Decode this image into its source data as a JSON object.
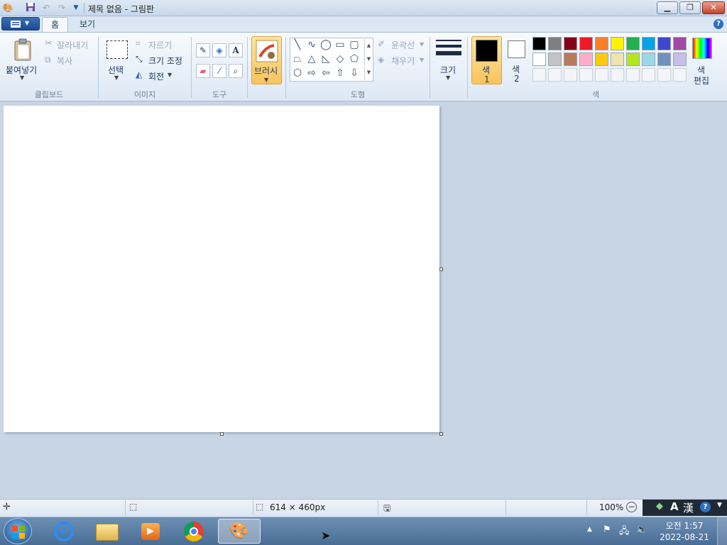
{
  "window": {
    "title": "제목 없음 - 그림판"
  },
  "tabs": [
    {
      "label": "홈"
    },
    {
      "label": "보기"
    }
  ],
  "clipboard": {
    "paste": "붙여넣기",
    "cut": "잘라내기",
    "copy": "복사",
    "group": "클립보드"
  },
  "image": {
    "select": "선택",
    "crop": "자르기",
    "resize": "크기 조정",
    "rotate": "회전",
    "group": "이미지"
  },
  "tools": {
    "group": "도구",
    "brush": "브러시"
  },
  "shapes": {
    "outline": "윤곽선",
    "fill": "채우기",
    "group": "도형"
  },
  "size": {
    "label": "크기"
  },
  "colors": {
    "color1": "색",
    "color1_num": "1",
    "color2": "색",
    "color2_num": "2",
    "edit1": "색",
    "edit2": "편집",
    "group": "색",
    "palette": [
      "#000000",
      "#7f7f7f",
      "#880015",
      "#ed1c24",
      "#ff7f27",
      "#fff200",
      "#22b14c",
      "#00a2e8",
      "#3f48cc",
      "#a349a4",
      "#ffffff",
      "#c3c3c3",
      "#b97a57",
      "#ffaec9",
      "#ffc90e",
      "#efe4b0",
      "#b5e61d",
      "#99d9ea",
      "#7092be",
      "#c8bfe7"
    ],
    "primary": "#000000",
    "secondary": "#ffffff"
  },
  "status": {
    "dimensions": "614 × 460px",
    "zoom": "100%"
  },
  "ime": {
    "mode1": "A",
    "mode2": "漢"
  },
  "clock": {
    "time": "오전 1:57",
    "date": "2022-08-21"
  }
}
